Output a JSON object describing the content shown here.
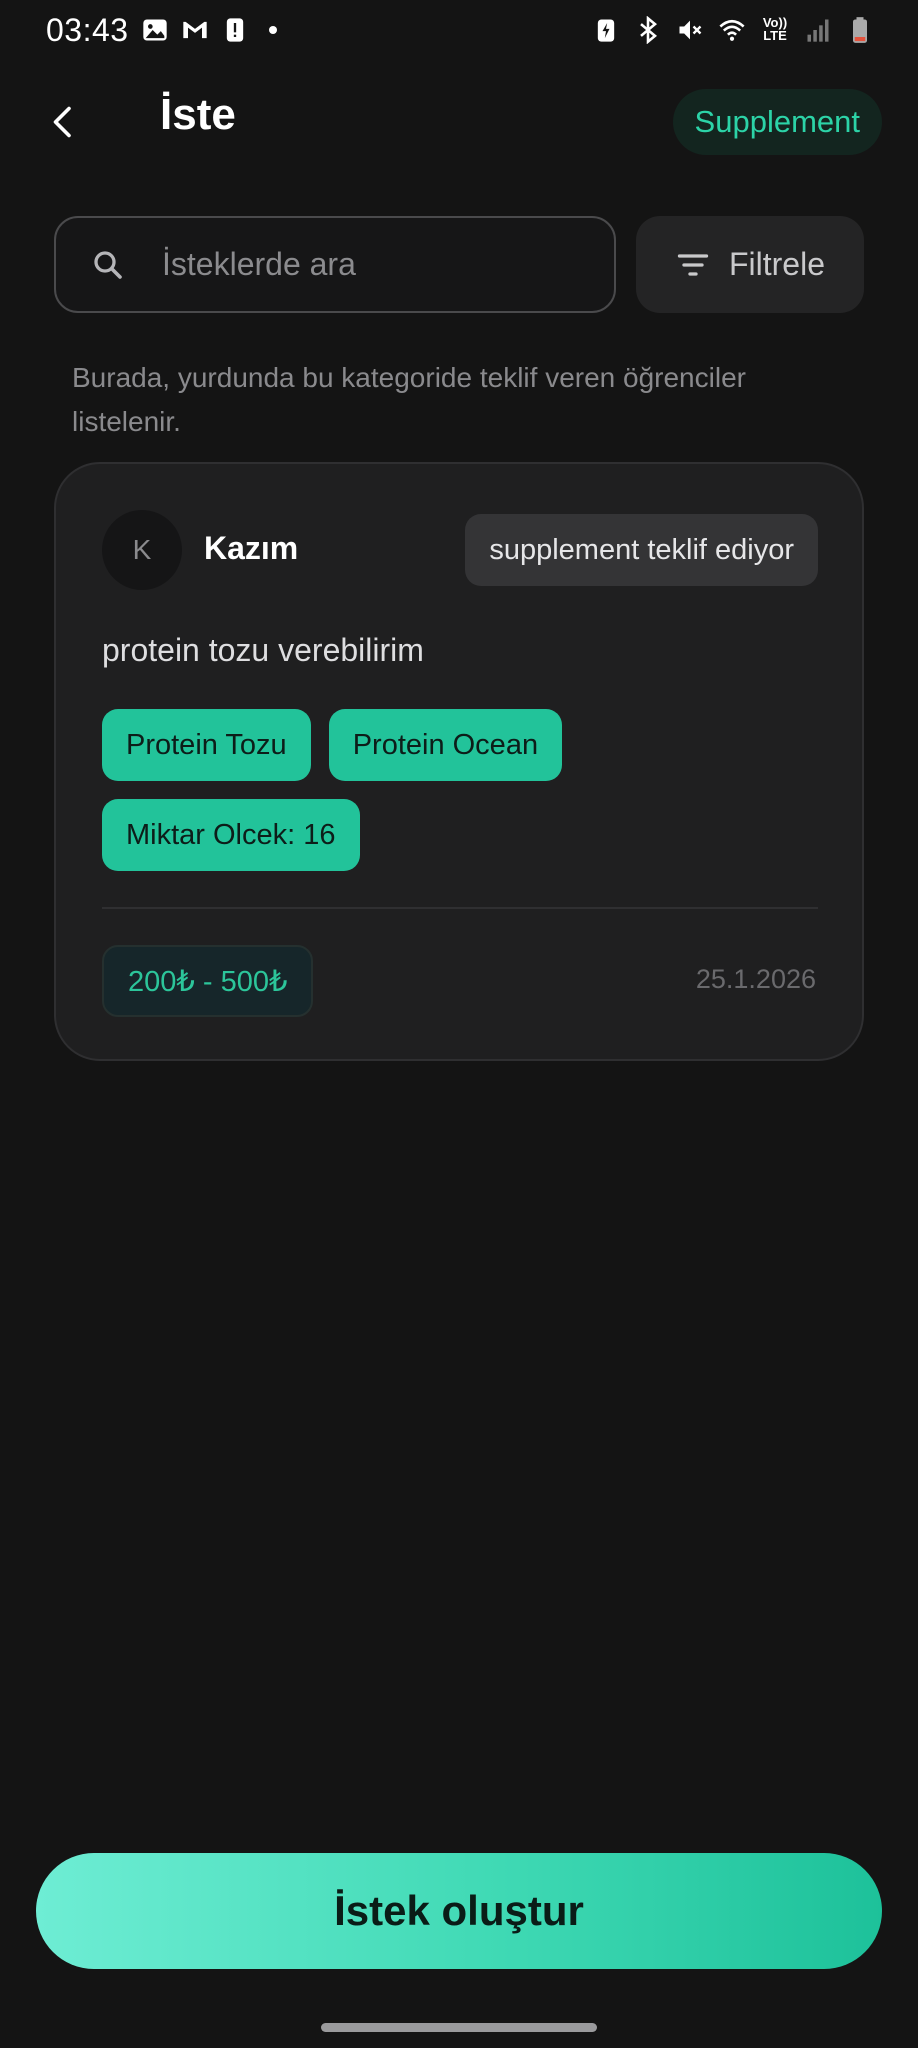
{
  "status_bar": {
    "time": "03:43",
    "network_label_top": "Vo))",
    "network_label_bottom": "LTE",
    "left_icons": [
      "gallery-icon",
      "gmail-icon",
      "alert-icon",
      "notification-dot"
    ],
    "right_icons": [
      "battery-saver-icon",
      "bluetooth-icon",
      "mute-icon",
      "wifi-icon",
      "volte-icon",
      "signal-icon",
      "battery-icon"
    ]
  },
  "header": {
    "title": "İste",
    "category": "Supplement"
  },
  "search": {
    "placeholder": "İsteklerde ara",
    "value": ""
  },
  "filter": {
    "label": "Filtrele"
  },
  "info_text": "Burada, yurdunda bu kategoride teklif veren öğrenciler listelenir.",
  "listing": {
    "avatar_initial": "K",
    "user_name": "Kazım",
    "offer_badge": "supplement teklif ediyor",
    "description": "protein tozu verebilirim",
    "tags": [
      "Protein Tozu",
      "Protein Ocean",
      "Miktar Olcek: 16"
    ],
    "price_range": "200₺ - 500₺",
    "date": "25.1.2026"
  },
  "cta": {
    "label": "İstek oluştur"
  },
  "colors": {
    "background": "#141414",
    "accent": "#22c39a",
    "accent_text": "#2cd3a7",
    "card": "#1f1f20",
    "cta_gradient_start": "#6eedd4",
    "cta_gradient_end": "#1dc19a"
  }
}
